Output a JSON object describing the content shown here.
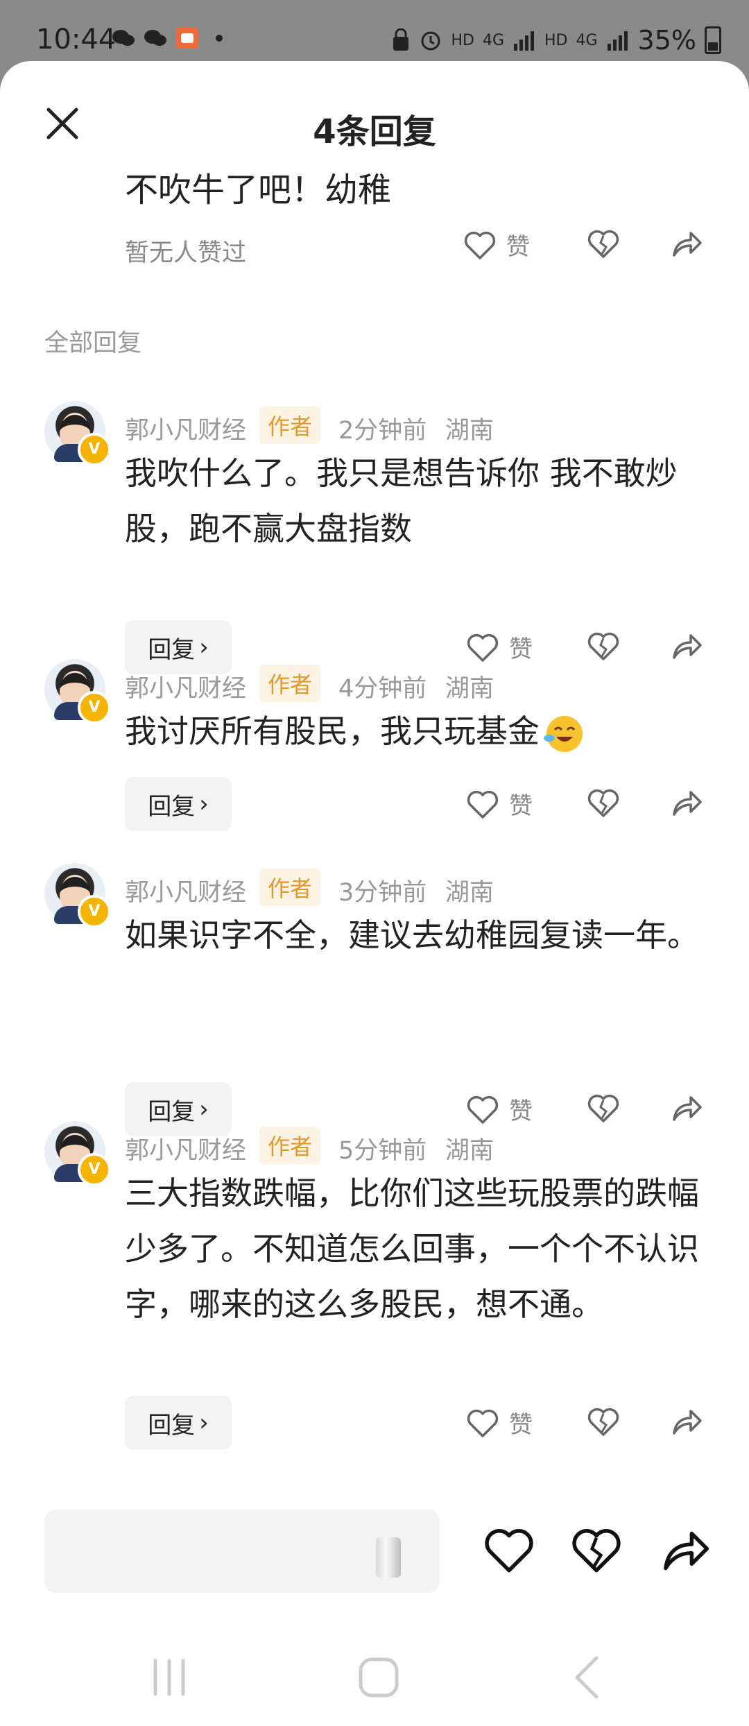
{
  "status_bar": {
    "time": "10:44",
    "battery": "35%",
    "net_labels": [
      "HD",
      "4G",
      "HD",
      "4G"
    ]
  },
  "sheet": {
    "title": "4条回复",
    "close_icon": "close-icon"
  },
  "original": {
    "text": "不吹牛了吧！幼稚",
    "likes_note": "暂无人赞过",
    "like_label": "赞"
  },
  "section_label": "全部回复",
  "replies": [
    {
      "author": "郭小凡财经",
      "tag": "作者",
      "time": "2分钟前",
      "region": "湖南",
      "text": "我吹什么了。我只是想告诉你 我不敢炒股，跑不赢大盘指数",
      "reply_label": "回复",
      "like_label": "赞"
    },
    {
      "author": "郭小凡财经",
      "tag": "作者",
      "time": "4分钟前",
      "region": "湖南",
      "text": "我讨厌所有股民，我只玩基金",
      "emoji": "laughing-crying-emoji",
      "reply_label": "回复",
      "like_label": "赞"
    },
    {
      "author": "郭小凡财经",
      "tag": "作者",
      "time": "3分钟前",
      "region": "湖南",
      "text": "如果识字不全，建议去幼稚园复读一年。",
      "reply_label": "回复",
      "like_label": "赞"
    },
    {
      "author": "郭小凡财经",
      "tag": "作者",
      "time": "5分钟前",
      "region": "湖南",
      "text": "三大指数跌幅，比你们这些玩股票的跌幅少多了。不知道怎么回事，一个个不认识字，哪来的这么多股民，想不通。",
      "reply_label": "回复",
      "like_label": "赞"
    }
  ],
  "bottom_bar": {
    "placeholder": ""
  },
  "colors": {
    "accent_tag": "#e09a2c",
    "muted_text": "#999999",
    "badge": "#f5b400"
  }
}
